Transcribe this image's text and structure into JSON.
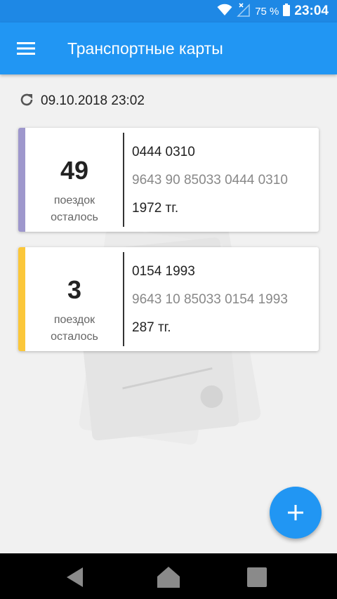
{
  "status_bar": {
    "battery_percent": "75 %",
    "time": "23:04",
    "icons": [
      "wifi-icon",
      "no-signal-icon",
      "battery-icon"
    ]
  },
  "app_bar": {
    "title": "Транспортные карты",
    "menu_icon": "hamburger-menu-icon"
  },
  "sync": {
    "icon": "refresh-icon",
    "timestamp": "09.10.2018 23:02"
  },
  "cards": [
    {
      "trips_count": "49",
      "trips_label_1": "поездок",
      "trips_label_2": "осталось",
      "short_number": "0444 0310",
      "full_number": "9643 90 85033 0444 0310",
      "balance": "1972 тг.",
      "accent_color": "#9e97cc"
    },
    {
      "trips_count": "3",
      "trips_label_1": "поездок",
      "trips_label_2": "осталось",
      "short_number": "0154 1993",
      "full_number": "9643 10 85033 0154 1993",
      "balance": "287 тг.",
      "accent_color": "#fbc73a"
    }
  ],
  "fab": {
    "icon": "plus-icon"
  },
  "nav_bar": {
    "icons": [
      "back-icon",
      "home-icon",
      "recents-icon"
    ]
  },
  "colors": {
    "primary": "#2196f3",
    "status_bar": "#1e88e5",
    "background": "#f1f1f1"
  }
}
